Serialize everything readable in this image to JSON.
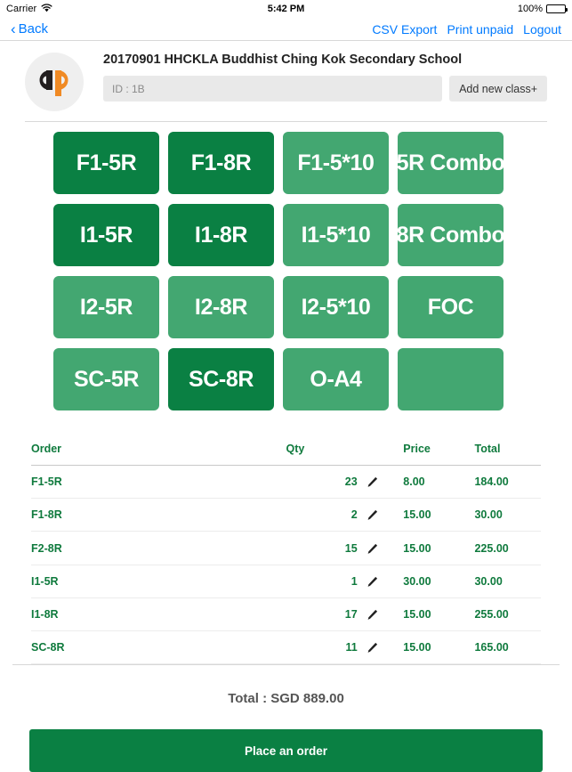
{
  "status_bar": {
    "carrier": "Carrier",
    "wifi_icon": "wifi-icon",
    "time": "5:42 PM",
    "battery_percent": "100%",
    "battery_icon": "battery-full-icon"
  },
  "nav_bar": {
    "back_label": "Back",
    "back_icon": "chevron-left-icon",
    "links": [
      {
        "label": "CSV Export",
        "name": "csv-export-link"
      },
      {
        "label": "Print unpaid",
        "name": "print-unpaid-link"
      },
      {
        "label": "Logout",
        "name": "logout-link"
      }
    ]
  },
  "header": {
    "logo_icon": "qp-logo-icon",
    "school_title": "20170901 HHCKLA Buddhist Ching Kok Secondary School",
    "class_input_value": "",
    "class_input_placeholder": "ID : 1B",
    "add_class_label": "Add new class+"
  },
  "colors": {
    "green_dark": "#0a8043",
    "green_light": "#43a771",
    "link_blue": "#007aff",
    "text_green": "#0f7a3d",
    "logo_orange": "#f08a24",
    "logo_black": "#231f20"
  },
  "product_grid": [
    {
      "label": "F1-5R",
      "shade": "dark"
    },
    {
      "label": "F1-8R",
      "shade": "dark"
    },
    {
      "label": "F1-5*10",
      "shade": "light"
    },
    {
      "label": "5R Combo",
      "shade": "light"
    },
    {
      "label": "I1-5R",
      "shade": "dark"
    },
    {
      "label": "I1-8R",
      "shade": "dark"
    },
    {
      "label": "I1-5*10",
      "shade": "light"
    },
    {
      "label": "8R Combo",
      "shade": "light"
    },
    {
      "label": "I2-5R",
      "shade": "light"
    },
    {
      "label": "I2-8R",
      "shade": "light"
    },
    {
      "label": "I2-5*10",
      "shade": "light"
    },
    {
      "label": "FOC",
      "shade": "light"
    },
    {
      "label": "SC-5R",
      "shade": "light"
    },
    {
      "label": "SC-8R",
      "shade": "dark"
    },
    {
      "label": "O-A4",
      "shade": "light"
    },
    {
      "label": "",
      "shade": "light"
    }
  ],
  "order_table": {
    "columns": [
      "Order",
      "Qty",
      "Price",
      "Total"
    ],
    "edit_icon": "pencil-icon",
    "rows": [
      {
        "order": "F1-5R",
        "qty": "23",
        "price": "8.00",
        "total": "184.00"
      },
      {
        "order": "F1-8R",
        "qty": "2",
        "price": "15.00",
        "total": "30.00"
      },
      {
        "order": "F2-8R",
        "qty": "15",
        "price": "15.00",
        "total": "225.00"
      },
      {
        "order": "I1-5R",
        "qty": "1",
        "price": "30.00",
        "total": "30.00"
      },
      {
        "order": "I1-8R",
        "qty": "17",
        "price": "15.00",
        "total": "255.00"
      },
      {
        "order": "SC-8R",
        "qty": "11",
        "price": "15.00",
        "total": "165.00"
      }
    ]
  },
  "footer": {
    "total_label": "Total : SGD 889.00",
    "place_order_label": "Place an order"
  }
}
